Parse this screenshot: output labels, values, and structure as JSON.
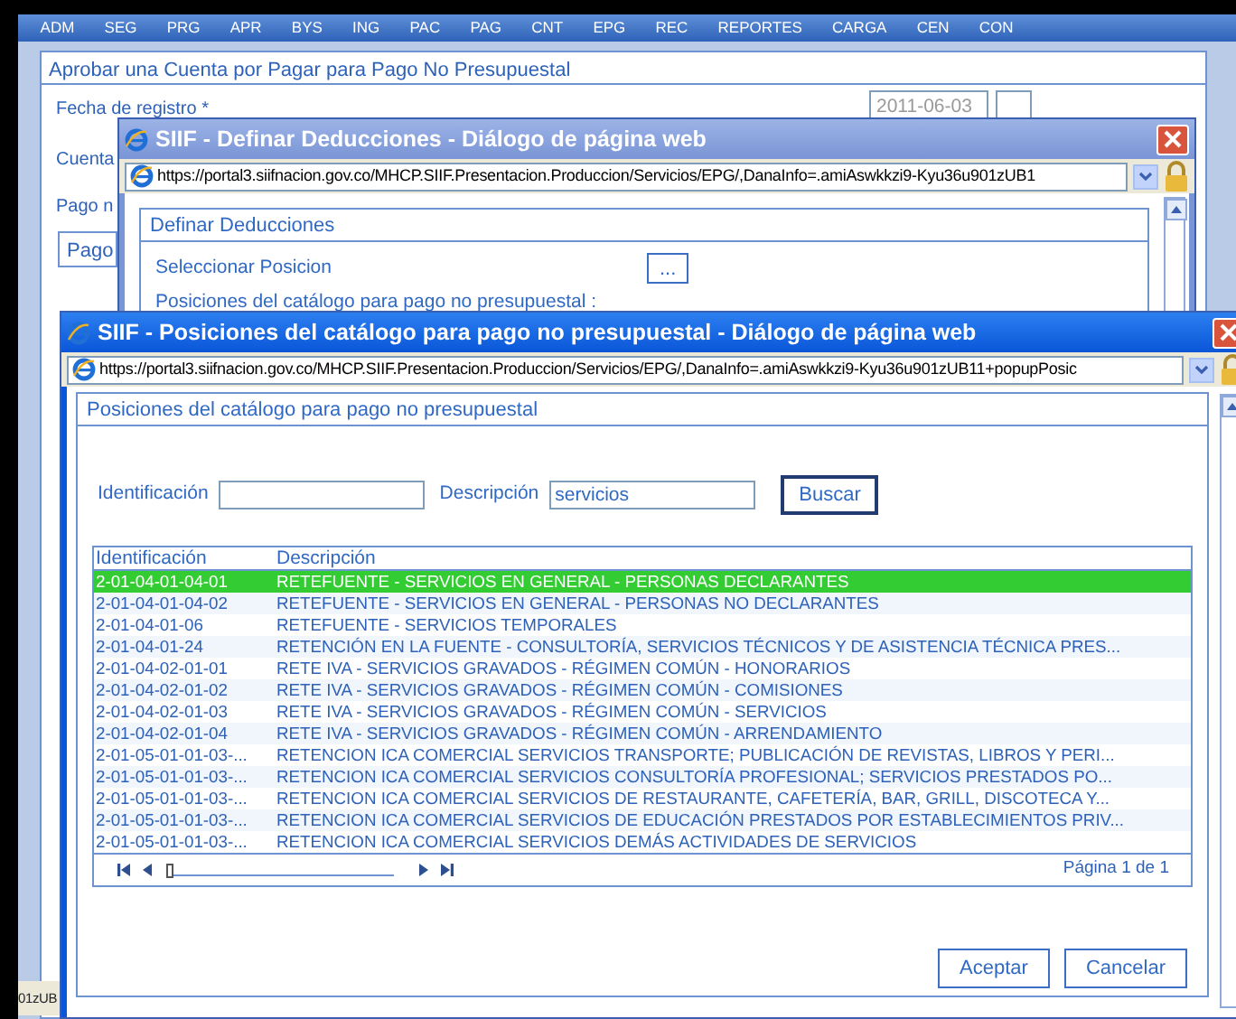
{
  "menu": [
    "ADM",
    "SEG",
    "PRG",
    "APR",
    "BYS",
    "ING",
    "PAC",
    "PAG",
    "CNT",
    "EPG",
    "REC",
    "REPORTES",
    "CARGA",
    "CEN",
    "CON"
  ],
  "page": {
    "title": "Aprobar una Cuenta por Pagar para Pago No Presupuestal",
    "fields": [
      {
        "label": "Fecha de registro *",
        "value": "2011-06-03"
      },
      {
        "label": "Cuenta"
      },
      {
        "label": "Pago n"
      }
    ],
    "tab": "Pago",
    "status_text": "01zUB"
  },
  "dialogs": [
    {
      "title": "SIIF - Definar Deducciones - Diálogo de página web",
      "active": false,
      "url": "https://portal3.siifnacion.gov.co/MHCP.SIIF.Presentacion.Produccion/Servicios/EPG/,DanaInfo=.amiAswkkzi9-Kyu36u901zUB1",
      "panel_title": "Definar Deducciones",
      "select_label": "Seleccionar Posicion",
      "select_button": "...",
      "positions_label": "Posiciones del catálogo para pago no presupuestal :"
    },
    {
      "title": "SIIF - Posiciones del catálogo para pago no presupuestal - Diálogo de página web",
      "active": true,
      "url": "https://portal3.siifnacion.gov.co/MHCP.SIIF.Presentacion.Produccion/Servicios/EPG/,DanaInfo=.amiAswkkzi9-Kyu36u901zUB11+popupPosic",
      "panel_title": "Posiciones del catálogo para pago no presupuestal",
      "search": [
        {
          "label": "Identificación"
        },
        {
          "label": "Descripción",
          "value": "servicios"
        }
      ],
      "search_button": "Buscar",
      "table": {
        "columns": [
          "Identificación",
          "Descripción"
        ],
        "rows": [
          {
            "id": "2-01-04-01-04-01",
            "description": "RETEFUENTE - SERVICIOS EN GENERAL - PERSONAS DECLARANTES",
            "selected": true
          },
          {
            "id": "2-01-04-01-04-02",
            "description": "RETEFUENTE - SERVICIOS EN GENERAL - PERSONAS NO DECLARANTES",
            "selected": false
          },
          {
            "id": "2-01-04-01-06",
            "description": "RETEFUENTE - SERVICIOS TEMPORALES",
            "selected": false
          },
          {
            "id": "2-01-04-01-24",
            "description": "RETENCIÓN EN LA FUENTE - CONSULTORÍA, SERVICIOS TÉCNICOS Y DE ASISTENCIA TÉCNICA PRES...",
            "selected": false
          },
          {
            "id": "2-01-04-02-01-01",
            "description": "RETE IVA - SERVICIOS GRAVADOS - RÉGIMEN COMÚN - HONORARIOS",
            "selected": false
          },
          {
            "id": "2-01-04-02-01-02",
            "description": "RETE IVA - SERVICIOS GRAVADOS - RÉGIMEN COMÚN - COMISIONES",
            "selected": false
          },
          {
            "id": "2-01-04-02-01-03",
            "description": "RETE IVA - SERVICIOS GRAVADOS - RÉGIMEN COMÚN - SERVICIOS",
            "selected": false
          },
          {
            "id": "2-01-04-02-01-04",
            "description": "RETE IVA - SERVICIOS GRAVADOS - RÉGIMEN COMÚN - ARRENDAMIENTO",
            "selected": false
          },
          {
            "id": "2-01-05-01-01-03-...",
            "description": "RETENCION ICA COMERCIAL SERVICIOS TRANSPORTE; PUBLICACIÓN DE REVISTAS, LIBROS Y PERI...",
            "selected": false
          },
          {
            "id": "2-01-05-01-01-03-...",
            "description": "RETENCION ICA COMERCIAL SERVICIOS CONSULTORÍA PROFESIONAL; SERVICIOS PRESTADOS PO...",
            "selected": false
          },
          {
            "id": "2-01-05-01-01-03-...",
            "description": "RETENCION ICA COMERCIAL SERVICIOS DE RESTAURANTE, CAFETERÍA, BAR, GRILL, DISCOTECA Y...",
            "selected": false
          },
          {
            "id": "2-01-05-01-01-03-...",
            "description": "RETENCION ICA COMERCIAL SERVICIOS DE EDUCACIÓN PRESTADOS POR ESTABLECIMIENTOS PRIV...",
            "selected": false
          },
          {
            "id": "2-01-05-01-01-03-...",
            "description": "RETENCION ICA COMERCIAL SERVICIOS DEMÁS ACTIVIDADES DE SERVICIOS",
            "selected": false
          }
        ]
      },
      "pager": {
        "level": 0,
        "page_text": "Página 1 de 1"
      },
      "buttons": [
        "Aceptar",
        "Cancelar"
      ]
    }
  ]
}
